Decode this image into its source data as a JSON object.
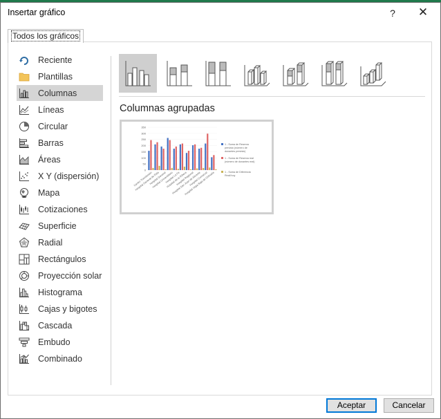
{
  "dialog": {
    "title": "Insertar gráfico",
    "help_label": "?",
    "close_label": "✕"
  },
  "tabs": [
    {
      "label": "Todos los gráficos",
      "active": true
    }
  ],
  "sidebar": {
    "items": [
      {
        "label": "Reciente",
        "icon": "recent-icon",
        "selected": false
      },
      {
        "label": "Plantillas",
        "icon": "folder-icon",
        "selected": false
      },
      {
        "label": "Columnas",
        "icon": "column-chart-icon",
        "selected": true
      },
      {
        "label": "Líneas",
        "icon": "line-chart-icon",
        "selected": false
      },
      {
        "label": "Circular",
        "icon": "pie-chart-icon",
        "selected": false
      },
      {
        "label": "Barras",
        "icon": "bar-chart-icon",
        "selected": false
      },
      {
        "label": "Áreas",
        "icon": "area-chart-icon",
        "selected": false
      },
      {
        "label": "X Y (dispersión)",
        "icon": "scatter-chart-icon",
        "selected": false
      },
      {
        "label": "Mapa",
        "icon": "map-chart-icon",
        "selected": false
      },
      {
        "label": "Cotizaciones",
        "icon": "stock-chart-icon",
        "selected": false
      },
      {
        "label": "Superficie",
        "icon": "surface-chart-icon",
        "selected": false
      },
      {
        "label": "Radial",
        "icon": "radar-chart-icon",
        "selected": false
      },
      {
        "label": "Rectángulos",
        "icon": "treemap-chart-icon",
        "selected": false
      },
      {
        "label": "Proyección solar",
        "icon": "sunburst-chart-icon",
        "selected": false
      },
      {
        "label": "Histograma",
        "icon": "histogram-chart-icon",
        "selected": false
      },
      {
        "label": "Cajas y bigotes",
        "icon": "box-whisker-chart-icon",
        "selected": false
      },
      {
        "label": "Cascada",
        "icon": "waterfall-chart-icon",
        "selected": false
      },
      {
        "label": "Embudo",
        "icon": "funnel-chart-icon",
        "selected": false
      },
      {
        "label": "Combinado",
        "icon": "combo-chart-icon",
        "selected": false
      }
    ]
  },
  "subtypes": {
    "selected_title": "Columnas agrupadas",
    "items": [
      {
        "icon": "clustered-column-icon",
        "selected": true
      },
      {
        "icon": "stacked-column-icon",
        "selected": false
      },
      {
        "icon": "100-stacked-column-icon",
        "selected": false
      },
      {
        "icon": "3d-clustered-column-icon",
        "selected": false
      },
      {
        "icon": "3d-stacked-column-icon",
        "selected": false
      },
      {
        "icon": "3d-100-stacked-column-icon",
        "selected": false
      },
      {
        "icon": "3d-column-icon",
        "selected": false
      }
    ]
  },
  "preview": {
    "y_ticks": [
      "350",
      "300",
      "250",
      "200",
      "150",
      "100",
      "50",
      "0"
    ],
    "legend": [
      {
        "label": "1 - Suma de Reserva previsto (número de donantes previsto)",
        "color": "#4472c4"
      },
      {
        "label": "1 - Suma de Reserva real (número de donantes real)",
        "color": "#e06666"
      },
      {
        "label": "1 - Suma de Diferencia Reali hoy",
        "color": "#c9b458"
      }
    ],
    "categories": [
      "Centro Transfusión",
      "Hospital General de Elda",
      "Hospital General",
      "Hospital Universitario",
      "Hospital La Fe",
      "Hospital de la Ribera",
      "Hospital Regional",
      "Hospital San Juan de Alicante",
      "Hospital Comarcal",
      "Hospital Vega Baja de Orihuela"
    ]
  },
  "buttons": {
    "accept_label": "Aceptar",
    "cancel_label": "Cancelar"
  },
  "colors": {
    "accent_top": "#1f7a4c",
    "selection_gray": "#d5d5d5",
    "default_button_border": "#0078d7",
    "series_blue": "#4472c4",
    "series_red": "#e06666",
    "series_gold": "#c9b458"
  }
}
